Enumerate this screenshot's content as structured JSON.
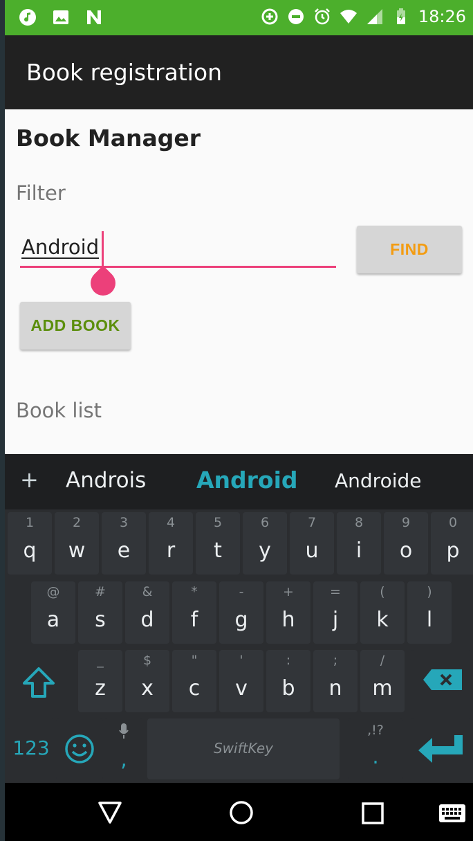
{
  "status_bar": {
    "time": "18:26",
    "left_icons": [
      "music-icon",
      "image-icon",
      "n-icon"
    ],
    "right_icons": [
      "add-circle-icon",
      "dnd-icon",
      "alarm-icon",
      "wifi-icon",
      "signal-icon",
      "battery-icon"
    ]
  },
  "app_bar": {
    "title": "Book registration"
  },
  "main": {
    "heading": "Book Manager",
    "filter_label": "Filter",
    "filter_value": "Android",
    "find_label": "FIND",
    "add_book_label": "ADD BOOK",
    "book_list_label": "Book list"
  },
  "keyboard": {
    "suggestions": [
      "Androis",
      "Android",
      "Androide"
    ],
    "add_symbol": "+",
    "row1": [
      {
        "hint": "1",
        "key": "q"
      },
      {
        "hint": "2",
        "key": "w"
      },
      {
        "hint": "3",
        "key": "e"
      },
      {
        "hint": "4",
        "key": "r"
      },
      {
        "hint": "5",
        "key": "t"
      },
      {
        "hint": "6",
        "key": "y"
      },
      {
        "hint": "7",
        "key": "u"
      },
      {
        "hint": "8",
        "key": "i"
      },
      {
        "hint": "9",
        "key": "o"
      },
      {
        "hint": "0",
        "key": "p"
      }
    ],
    "row2": [
      {
        "hint": "@",
        "key": "a"
      },
      {
        "hint": "#",
        "key": "s"
      },
      {
        "hint": "&",
        "key": "d"
      },
      {
        "hint": "*",
        "key": "f"
      },
      {
        "hint": "-",
        "key": "g"
      },
      {
        "hint": "+",
        "key": "h"
      },
      {
        "hint": "=",
        "key": "j"
      },
      {
        "hint": "(",
        "key": "k"
      },
      {
        "hint": ")",
        "key": "l"
      }
    ],
    "row3": [
      {
        "hint": "_",
        "key": "z"
      },
      {
        "hint": "$",
        "key": "x"
      },
      {
        "hint": "\"",
        "key": "c"
      },
      {
        "hint": "'",
        "key": "v"
      },
      {
        "hint": ":",
        "key": "b"
      },
      {
        "hint": ";",
        "key": "n"
      },
      {
        "hint": "/",
        "key": "m"
      }
    ],
    "numbers_label": "123",
    "comma_label": ",",
    "period_label": ".",
    "period_hint": ",!?",
    "space_brand": "SwiftKey"
  },
  "colors": {
    "status_bar": "#4caf2c",
    "app_bar": "#212121",
    "accent": "#ec407a",
    "find_text": "#f39c12",
    "add_text": "#5b8e0c",
    "keyboard_accent": "#26a7b9"
  }
}
